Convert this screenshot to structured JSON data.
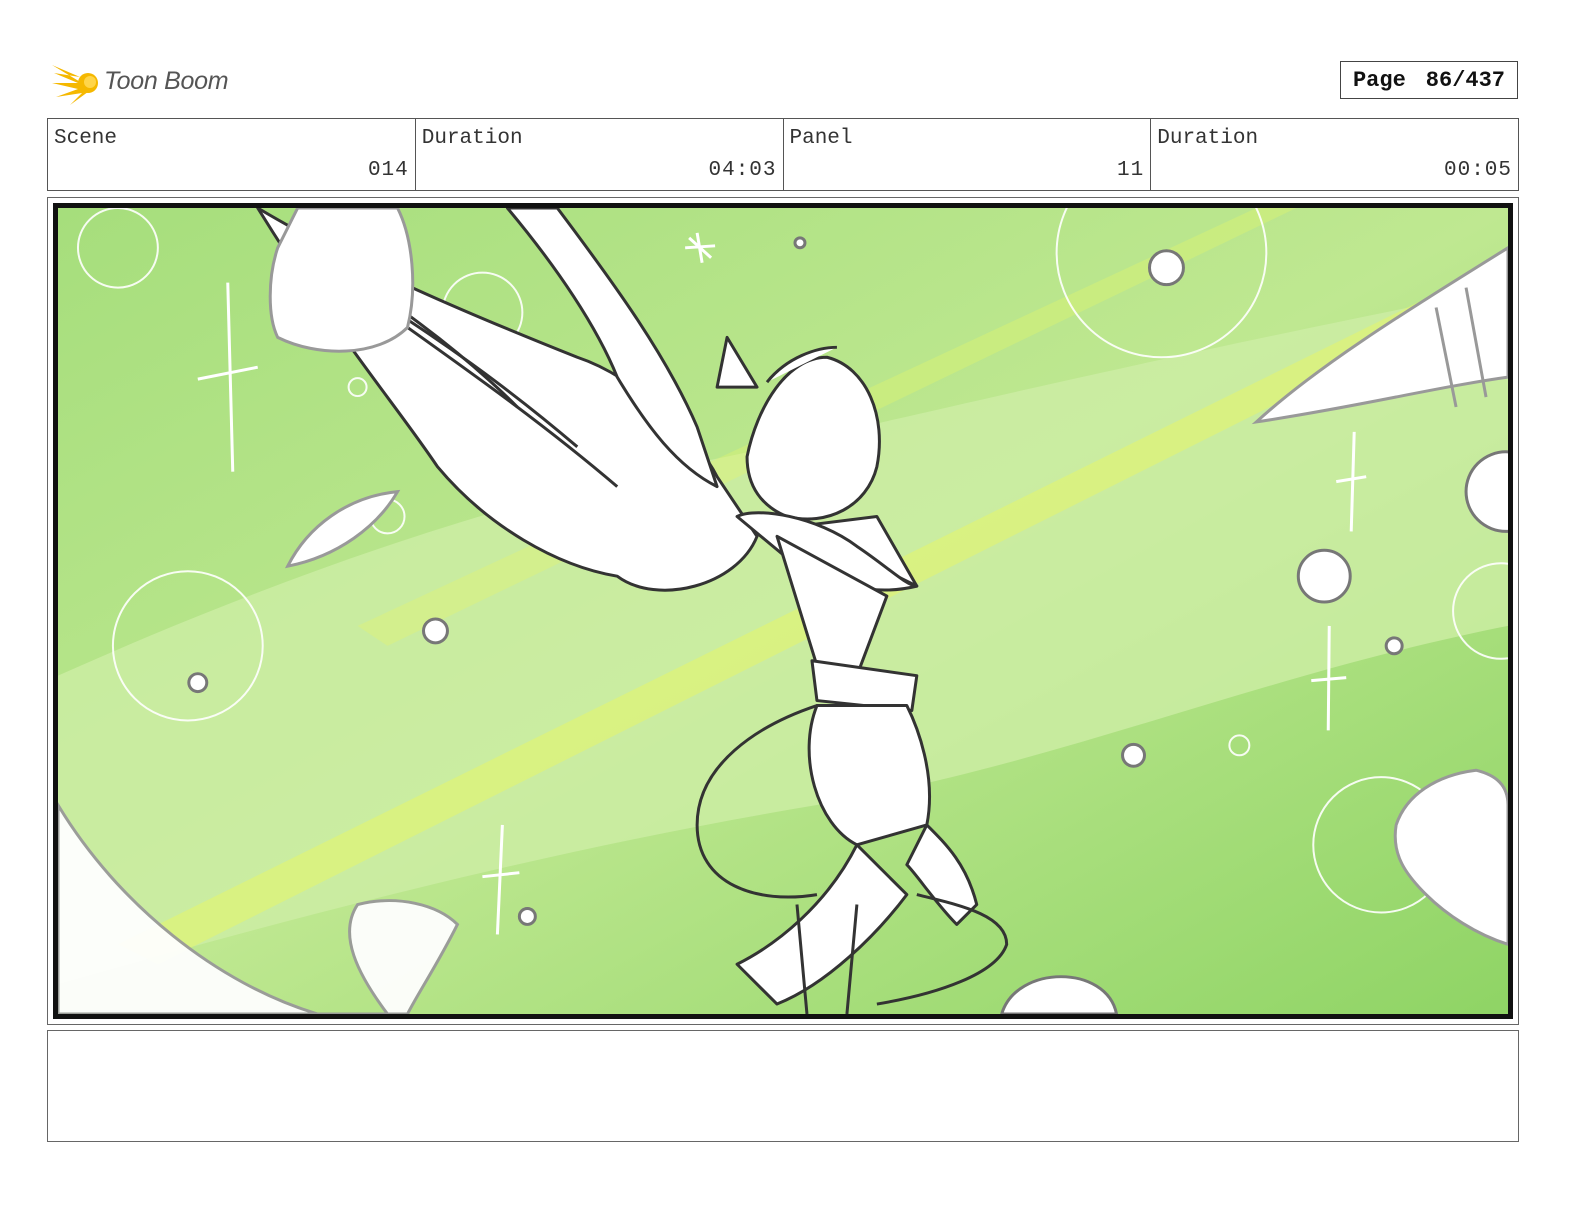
{
  "header": {
    "brand": "Toon Boom",
    "page_label": "Page",
    "page_value": "86/437"
  },
  "info": [
    {
      "label": "Scene",
      "value": "014"
    },
    {
      "label": "Duration",
      "value": "04:03"
    },
    {
      "label": "Panel",
      "value": "11"
    },
    {
      "label": "Duration",
      "value": "00:05"
    }
  ],
  "notes": {
    "text": ""
  },
  "colors": {
    "panel_bg_light": "#c6ec9d",
    "panel_bg_mid": "#9fdc74",
    "panel_bg_dark": "#82cf5c",
    "highlight_yellow": "#e6f56a",
    "logo_yellow": "#f5b800"
  }
}
